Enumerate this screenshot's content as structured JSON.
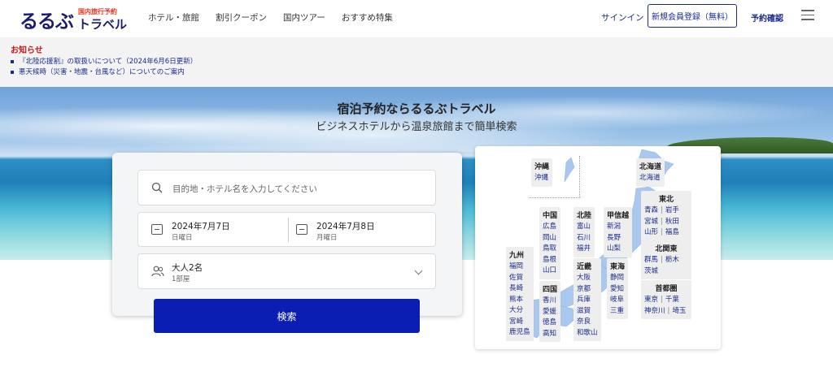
{
  "header": {
    "logo_main": "るるぶ",
    "logo_sub": "国内旅行予約",
    "logo_travel": "トラベル",
    "nav": [
      "ホテル・旅館",
      "割引クーポン",
      "国内ツアー",
      "おすすめ特集"
    ],
    "signin": "サインイン",
    "register": "新規会員登録（無料）",
    "reserve_check": "予約確認"
  },
  "notice": {
    "title": "お知らせ",
    "items": [
      "『北陸応援割』の取扱いについて（2024年6月6日更新）",
      "悪天候時（災害・地震・台風など）についてのご案内"
    ]
  },
  "hero": {
    "title": "宿泊予約ならるるぶトラベル",
    "subtitle": "ビジネスホテルから温泉旅館まで簡単検索"
  },
  "search": {
    "destination_placeholder": "目的地・ホテル名を入力してください",
    "checkin_date": "2024年7月7日",
    "checkin_weekday": "日曜日",
    "checkout_date": "2024年7月8日",
    "checkout_weekday": "月曜日",
    "guests": "大人2名",
    "rooms": "1部屋",
    "button": "検索"
  },
  "map": {
    "regions": {
      "okinawa": {
        "name": "沖縄",
        "prefs": [
          "沖縄"
        ]
      },
      "hokkaido": {
        "name": "北海道",
        "prefs": [
          "北海道"
        ]
      },
      "tohoku": {
        "name": "東北",
        "rows": [
          [
            "青森",
            "岩手"
          ],
          [
            "宮城",
            "秋田"
          ],
          [
            "山形",
            "福島"
          ]
        ]
      },
      "kitakanto": {
        "name": "北関東",
        "rows": [
          [
            "群馬",
            "栃木"
          ],
          [
            "茨城"
          ]
        ]
      },
      "shutoken": {
        "name": "首都圏",
        "rows": [
          [
            "東京",
            "千葉"
          ],
          [
            "神奈川",
            "埼玉"
          ]
        ]
      },
      "koshinetsu": {
        "name": "甲信越",
        "prefs": [
          "新潟",
          "長野",
          "山梨"
        ]
      },
      "tokai": {
        "name": "東海",
        "prefs": [
          "静岡",
          "愛知",
          "岐阜",
          "三重"
        ]
      },
      "hokuriku": {
        "name": "北陸",
        "prefs": [
          "富山",
          "石川",
          "福井"
        ]
      },
      "kinki": {
        "name": "近畿",
        "prefs": [
          "大阪",
          "京都",
          "兵庫",
          "滋賀",
          "奈良",
          "和歌山"
        ]
      },
      "chugoku": {
        "name": "中国",
        "prefs": [
          "広島",
          "岡山",
          "鳥取",
          "島根",
          "山口"
        ]
      },
      "shikoku": {
        "name": "四国",
        "prefs": [
          "香川",
          "愛媛",
          "徳島",
          "高知"
        ]
      },
      "kyushu": {
        "name": "九州",
        "prefs": [
          "福岡",
          "佐賀",
          "長崎",
          "熊本",
          "大分",
          "宮崎",
          "鹿児島"
        ]
      }
    }
  },
  "colors": {
    "brand_navy": "#1a2a8c",
    "search_button": "#0b1eb4",
    "notice_red": "#c4161c"
  }
}
